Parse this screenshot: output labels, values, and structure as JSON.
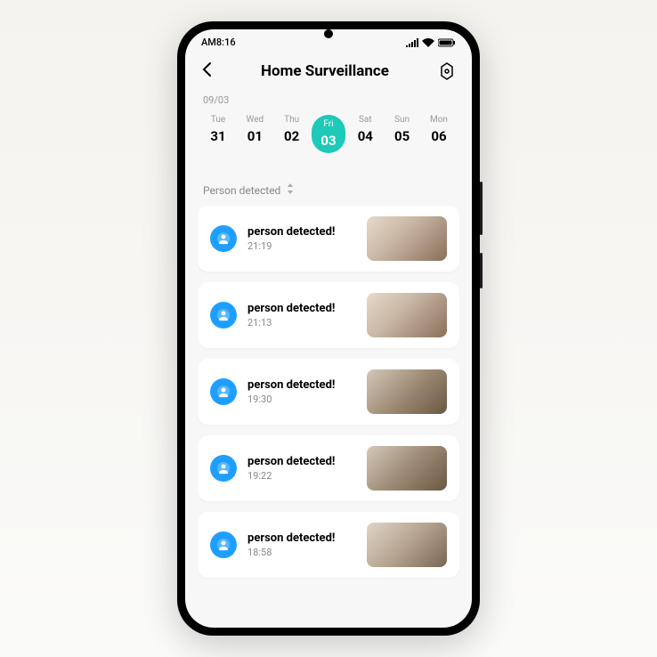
{
  "status": {
    "time": "AM8:16",
    "signal": "▪▪▪▪",
    "wifi": "◉",
    "battery": "▭"
  },
  "header": {
    "title": "Home  Surveillance"
  },
  "date_label": "09/03",
  "calendar": [
    {
      "name": "Tue",
      "num": "31",
      "selected": false
    },
    {
      "name": "Wed",
      "num": "01",
      "selected": false
    },
    {
      "name": "Thu",
      "num": "02",
      "selected": false
    },
    {
      "name": "Fri",
      "num": "03",
      "selected": true
    },
    {
      "name": "Sat",
      "num": "04",
      "selected": false
    },
    {
      "name": "Sun",
      "num": "05",
      "selected": false
    },
    {
      "name": "Mon",
      "num": "06",
      "selected": false
    }
  ],
  "filter": {
    "label": "Person detected"
  },
  "events": [
    {
      "title": "person detected!",
      "time": "21:19",
      "thumb": "s1"
    },
    {
      "title": "person detected!",
      "time": "21:13",
      "thumb": "s1"
    },
    {
      "title": "person detected!",
      "time": "19:30",
      "thumb": "s2"
    },
    {
      "title": "person detected!",
      "time": "19:22",
      "thumb": "s2"
    },
    {
      "title": "person detected!",
      "time": "18:58",
      "thumb": "s3"
    }
  ]
}
